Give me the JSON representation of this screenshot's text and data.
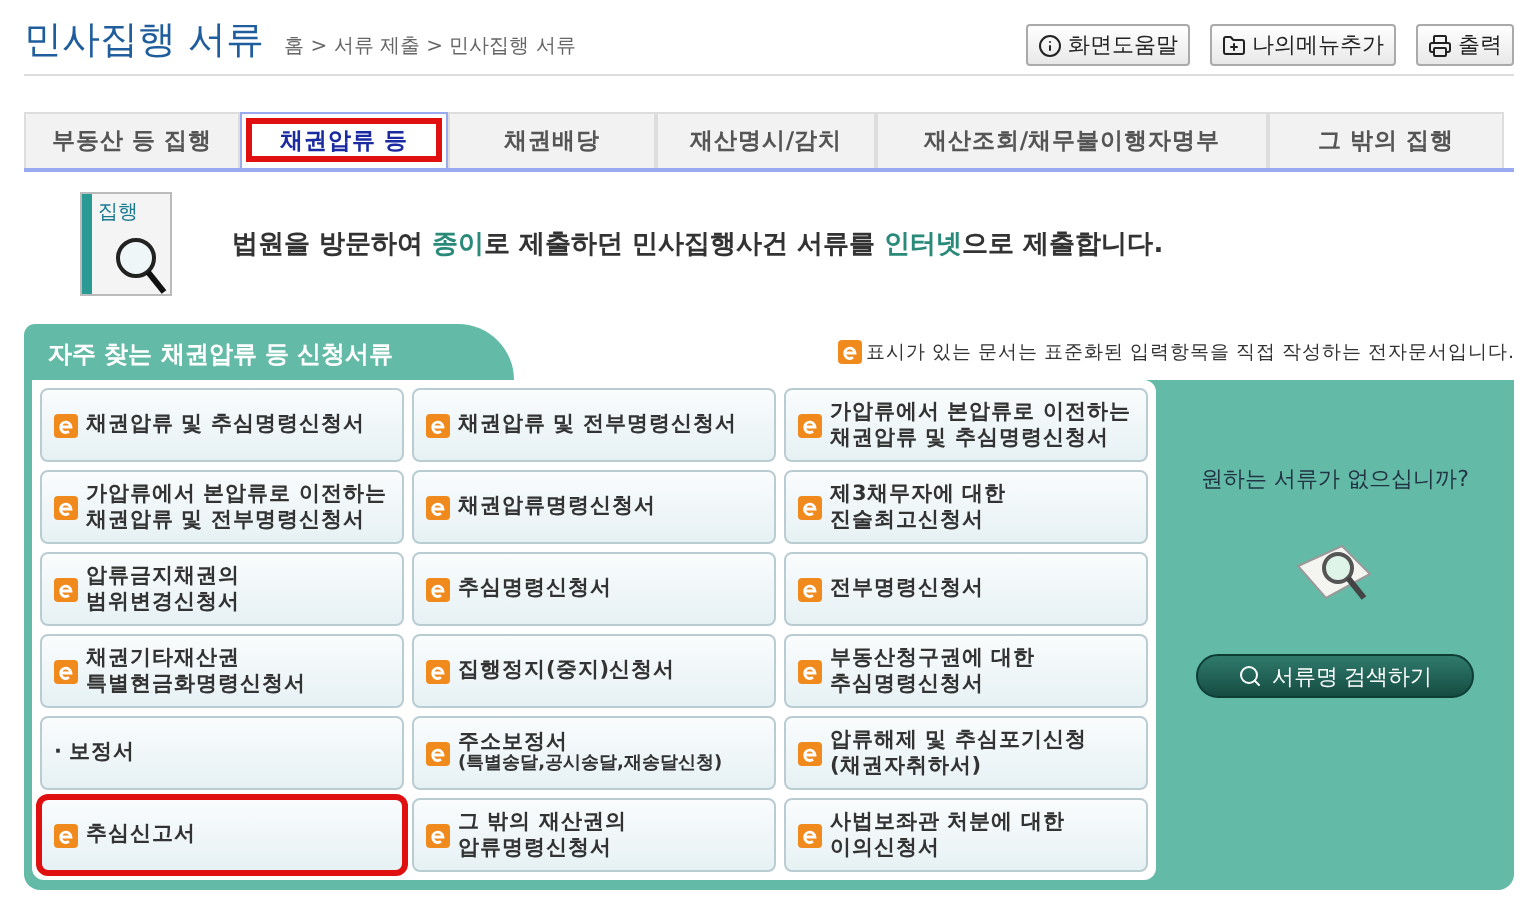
{
  "header": {
    "title": "민사집행 서류",
    "breadcrumb": "홈 > 서류 제출 > 민사집행 서류",
    "buttons": [
      {
        "label": "화면도움말",
        "kind": "info"
      },
      {
        "label": "나의메뉴추가",
        "kind": "folder"
      },
      {
        "label": "출력",
        "kind": "print"
      }
    ]
  },
  "tabs": [
    {
      "label": "부동산 등 집행",
      "selected": false,
      "highlighted": false
    },
    {
      "label": "채권압류 등",
      "selected": true,
      "highlighted": true
    },
    {
      "label": "채권배당",
      "selected": false,
      "highlighted": false
    },
    {
      "label": "재산명시/감치",
      "selected": false,
      "highlighted": false
    },
    {
      "label": "재산조회/채무불이행자명부",
      "selected": false,
      "highlighted": false
    },
    {
      "label": "그 밖의 집행",
      "selected": false,
      "highlighted": false
    }
  ],
  "intro": {
    "badge": "집행",
    "segments": [
      {
        "text": "법원을 방문하여 ",
        "accent": false
      },
      {
        "text": "종이",
        "accent": true
      },
      {
        "text": "로 제출하던 민사집행사건 서류를 ",
        "accent": false
      },
      {
        "text": "인터넷",
        "accent": true
      },
      {
        "text": "으로 제출합니다.",
        "accent": false
      }
    ]
  },
  "panel": {
    "title": "자주 찾는 채권압류 등 신청서류",
    "legend": "표시가 있는 문서는 표준화된 입력항목을 직접 작성하는 전자문서입니다.",
    "items": [
      {
        "kind": "e",
        "lines": [
          "채권압류 및 추심명령신청서"
        ],
        "highlighted": false
      },
      {
        "kind": "e",
        "lines": [
          "채권압류 및 전부명령신청서"
        ],
        "highlighted": false
      },
      {
        "kind": "e",
        "lines": [
          "가압류에서 본압류로 이전하는",
          "채권압류 및 추심명령신청서"
        ],
        "highlighted": false
      },
      {
        "kind": "e",
        "lines": [
          "가압류에서 본압류로 이전하는",
          "채권압류 및 전부명령신청서"
        ],
        "highlighted": false
      },
      {
        "kind": "e",
        "lines": [
          "채권압류명령신청서"
        ],
        "highlighted": false
      },
      {
        "kind": "e",
        "lines": [
          "제3채무자에 대한",
          "진술최고신청서"
        ],
        "highlighted": false
      },
      {
        "kind": "e",
        "lines": [
          "압류금지채권의",
          "범위변경신청서"
        ],
        "highlighted": false
      },
      {
        "kind": "e",
        "lines": [
          "추심명령신청서"
        ],
        "highlighted": false
      },
      {
        "kind": "e",
        "lines": [
          "전부명령신청서"
        ],
        "highlighted": false
      },
      {
        "kind": "e",
        "lines": [
          "채권기타재산권",
          "특별현금화명령신청서"
        ],
        "highlighted": false
      },
      {
        "kind": "e",
        "lines": [
          "집행정지(중지)신청서"
        ],
        "highlighted": false
      },
      {
        "kind": "e",
        "lines": [
          "부동산청구권에 대한",
          "추심명령신청서"
        ],
        "highlighted": false
      },
      {
        "kind": "plain",
        "lines": [
          "· 보정서"
        ],
        "highlighted": false
      },
      {
        "kind": "e",
        "lines": [
          "주소보정서"
        ],
        "note": "(특별송달,공시송달,재송달신청)",
        "highlighted": false
      },
      {
        "kind": "e",
        "lines": [
          "압류해제 및 추심포기신청",
          "(채권자취하서)"
        ],
        "highlighted": false
      },
      {
        "kind": "e",
        "lines": [
          "추심신고서"
        ],
        "highlighted": true
      },
      {
        "kind": "e",
        "lines": [
          "그 밖의 재산권의",
          "압류명령신청서"
        ],
        "highlighted": false
      },
      {
        "kind": "e",
        "lines": [
          "사법보좌관 처분에 대한",
          "이의신청서"
        ],
        "highlighted": false
      }
    ],
    "side": {
      "question": "원하는 서류가 없으십니까?",
      "button": "서류명 검색하기"
    }
  }
}
